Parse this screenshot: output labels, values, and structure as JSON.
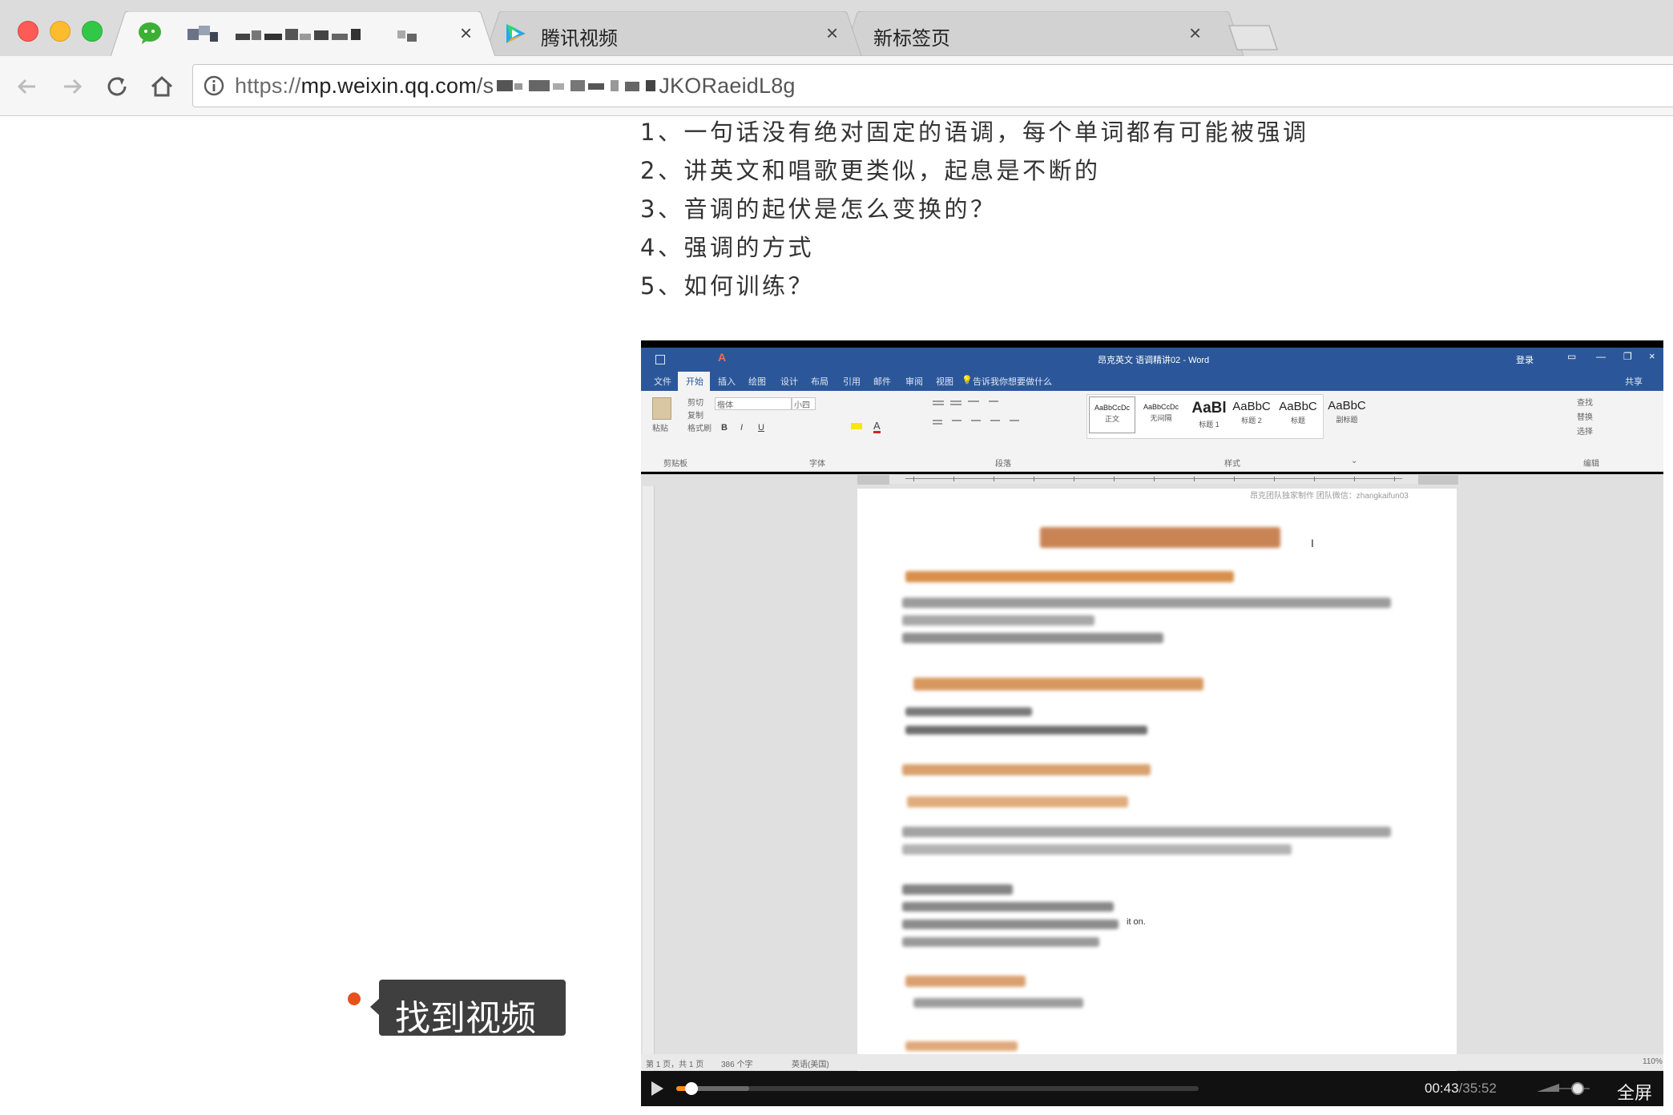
{
  "tabs": [
    {
      "title": "",
      "active": true,
      "favicon": "wechat-icon"
    },
    {
      "title": "腾讯视频",
      "active": false,
      "favicon": "tencent-video-icon"
    },
    {
      "title": "新标签页",
      "active": false,
      "favicon": ""
    }
  ],
  "address_bar": {
    "scheme": "https://",
    "host": "mp.weixin.qq.com",
    "path_start": "/s",
    "path_end": "JKORaeidL8g"
  },
  "article": {
    "lines": [
      "1、一句话没有绝对固定的语调，每个单词都有可能被强调",
      "2、讲英文和唱歌更类似，起息是不断的",
      "3、音调的起伏是怎么变换的？",
      "4、强调的方式",
      "5、如何训练？"
    ]
  },
  "video": {
    "word": {
      "title": "昂克英文 语调精讲02 - Word",
      "login": "登录",
      "share": "共享",
      "ribbon_tabs": [
        "文件",
        "开始",
        "插入",
        "绘图",
        "设计",
        "布局",
        "引用",
        "邮件",
        "审阅",
        "视图"
      ],
      "tell_me": "告诉我你想要做什么",
      "clipboard": {
        "paste": "粘贴",
        "cut": "剪切",
        "copy": "复制",
        "format_painter": "格式刷",
        "group": "剪贴板"
      },
      "font": {
        "name": "楷体",
        "size": "小四",
        "group": "字体"
      },
      "paragraph_group": "段落",
      "styles_group": "样式",
      "editing": {
        "find": "查找",
        "replace": "替换",
        "select": "选择",
        "group": "编辑"
      },
      "styles": [
        {
          "preview": "AaBbCcDc",
          "label": "正文"
        },
        {
          "preview": "AaBbCcDc",
          "label": "无间隔"
        },
        {
          "preview": "AaBl",
          "label": "标题 1"
        },
        {
          "preview": "AaBbC",
          "label": "标题 2"
        },
        {
          "preview": "AaBbC",
          "label": "标题"
        },
        {
          "preview": "AaBbC",
          "label": "副标题"
        }
      ],
      "header_text": "昂克团队独家制作  团队微信：zhangkaifun03",
      "doc_inline_text": "it on.",
      "status": {
        "page": "第 1 页，共 1 页",
        "words": "386 个字",
        "lang": "英语(美国)",
        "zoom": "110%"
      }
    },
    "time_current": "00:43",
    "time_total": "/35:52",
    "fullscreen_label": "全屏",
    "progress_fraction": 0.02,
    "buffered_fraction": 0.14,
    "volume_fraction": 0.65
  },
  "tooltip": {
    "text": "找到视频"
  },
  "colors": {
    "word_blue": "#2b579a",
    "tooltip_bg": "#3f3f3f",
    "tooltip_dot": "#e8501c",
    "progress_fill": "#ff8c1a"
  }
}
